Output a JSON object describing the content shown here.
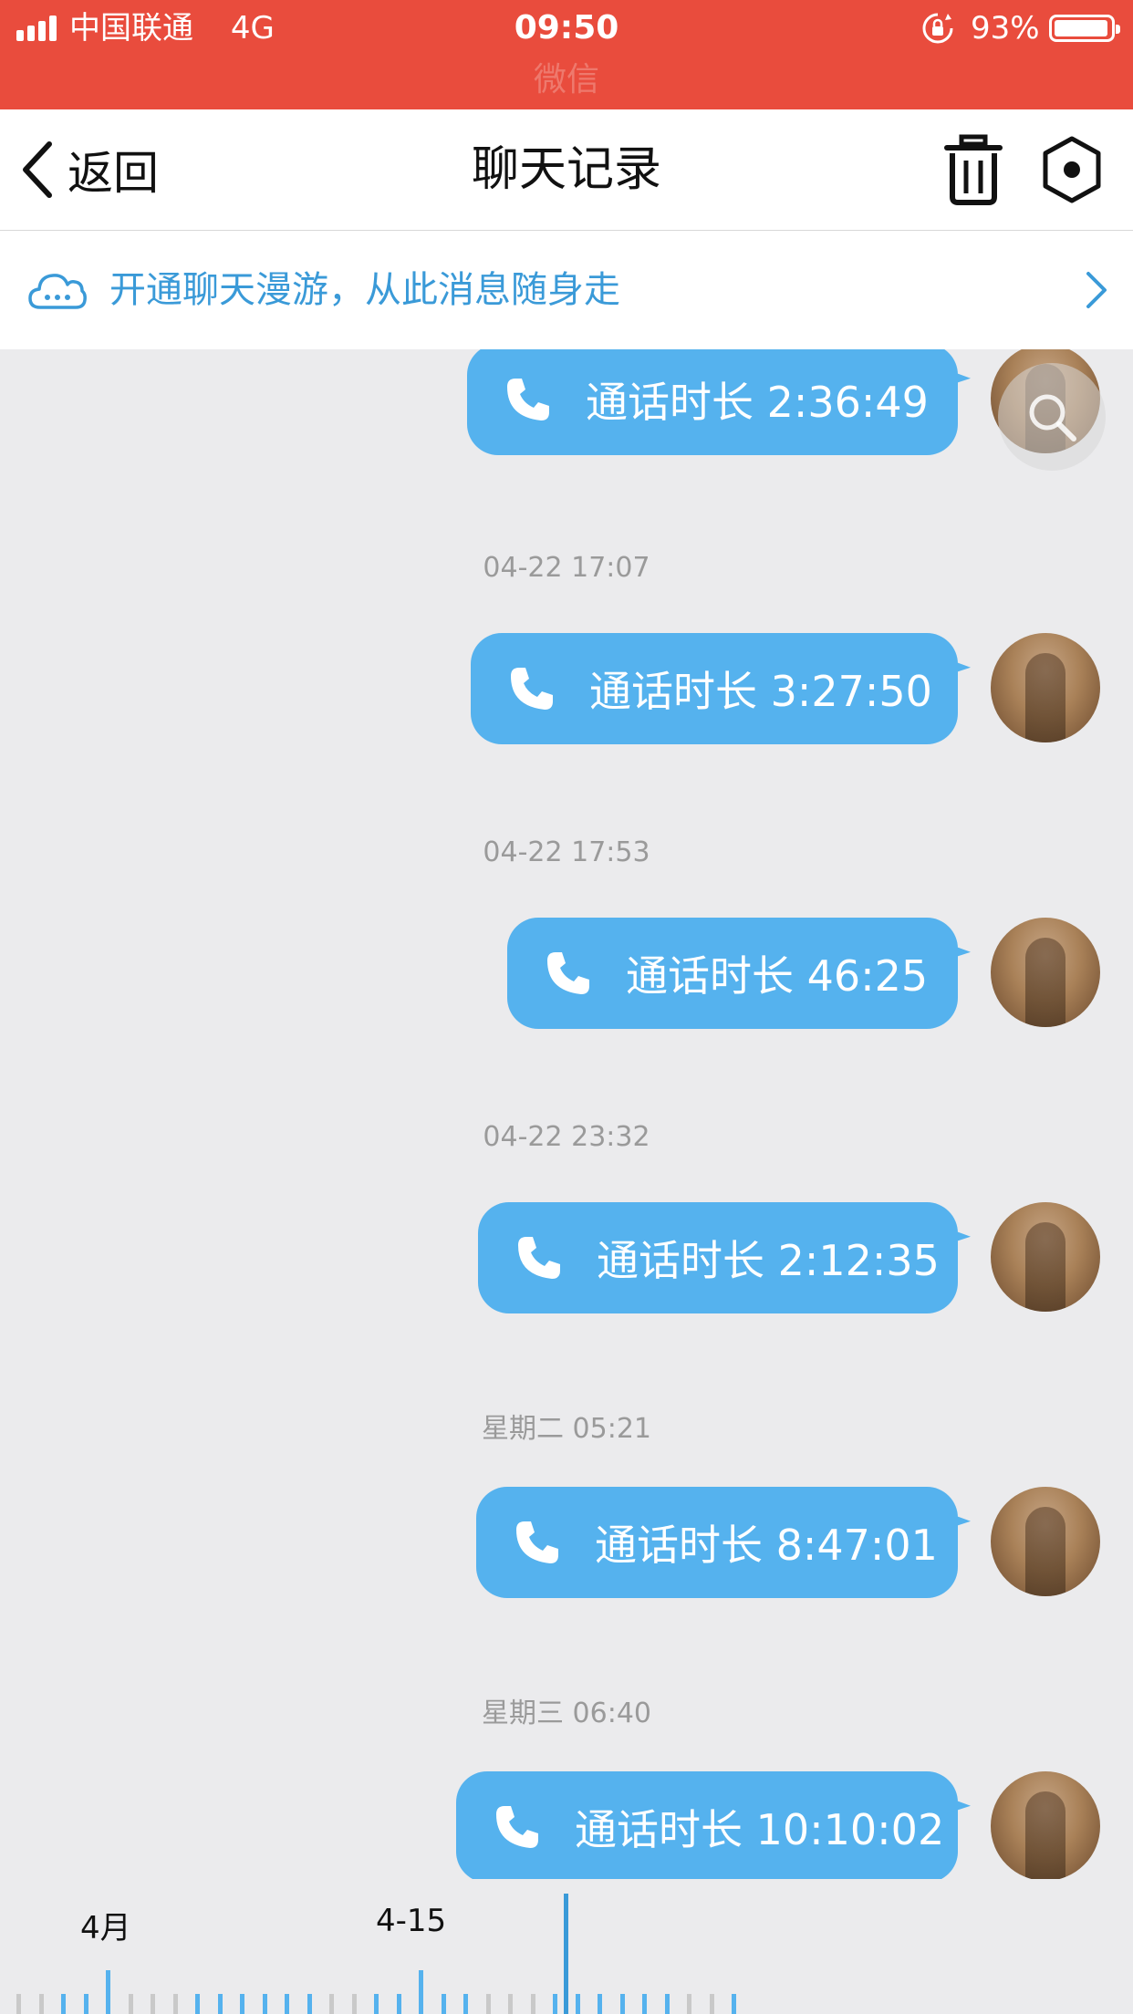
{
  "status_bar": {
    "carrier": "中国联通",
    "network": "4G",
    "time": "09:50",
    "app_hint": "微信",
    "battery": "93%"
  },
  "nav": {
    "back_label": "返回",
    "title": "聊天记录"
  },
  "banner": {
    "text": "开通聊天漫游，从此消息随身走"
  },
  "messages": [
    {
      "timestamp": "",
      "text": "通话时长 2:36:49"
    },
    {
      "timestamp": "04-22 17:07",
      "text": "通话时长 3:27:50"
    },
    {
      "timestamp": "04-22 17:53",
      "text": "通话时长 46:25"
    },
    {
      "timestamp": "04-22 23:32",
      "text": "通话时长 2:12:35"
    },
    {
      "timestamp": "星期二 05:21",
      "text": "通话时长 8:47:01"
    },
    {
      "timestamp": "星期三 06:40",
      "text": "通话时长 10:10:02"
    }
  ],
  "timeline": {
    "labels": [
      "4月",
      "4-15"
    ]
  },
  "colors": {
    "status_bar": "#e94c3d",
    "bubble": "#55b2ee",
    "accent": "#3a9ad8",
    "background": "#ebebed"
  }
}
